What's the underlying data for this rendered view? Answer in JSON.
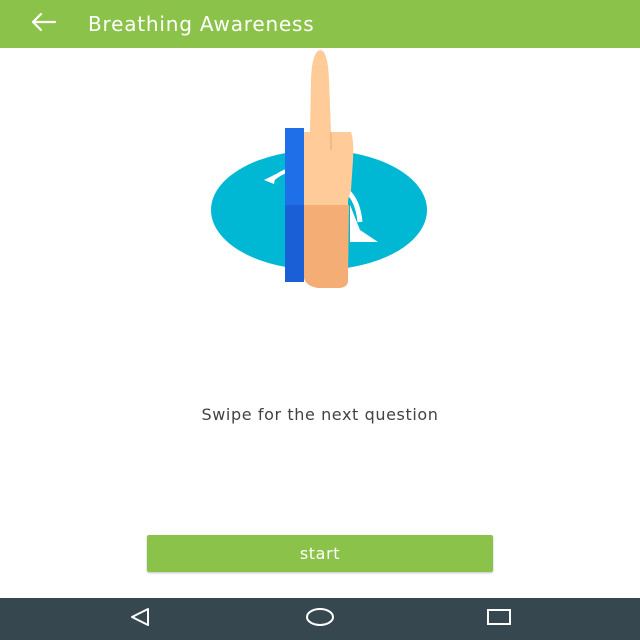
{
  "appbar": {
    "title": "Breathing Awareness",
    "back_icon": "arrow-back-icon",
    "background": "#8bc34a"
  },
  "main": {
    "illustration_icon": "swipe-gesture-icon",
    "hint": "Swipe for the next question",
    "start_label": "start",
    "accent": "#8bc34a"
  },
  "navbar": {
    "background": "#37474f",
    "icons": [
      "nav-back-icon",
      "nav-home-icon",
      "nav-recents-icon"
    ]
  }
}
